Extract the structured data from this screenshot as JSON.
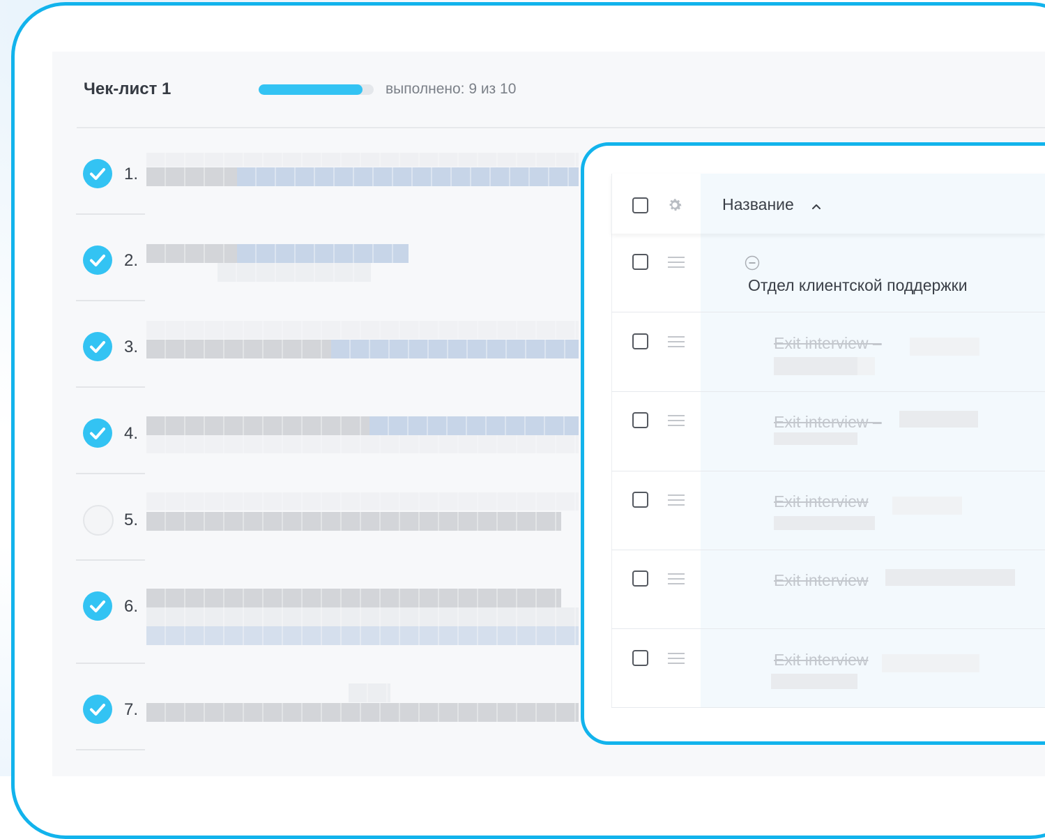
{
  "checklist": {
    "title": "Чек-лист 1",
    "progress_text": "выполнено: 9 из 10",
    "progress_fraction": 0.9,
    "accent_color": "#33c3f3",
    "tasks": [
      {
        "number": "1.",
        "done": true
      },
      {
        "number": "2.",
        "done": true
      },
      {
        "number": "3.",
        "done": true
      },
      {
        "number": "4.",
        "done": true
      },
      {
        "number": "5.",
        "done": false
      },
      {
        "number": "6.",
        "done": true
      },
      {
        "number": "7.",
        "done": true
      }
    ]
  },
  "table": {
    "column_name": "Название",
    "sort_icon": "chevron-up-icon",
    "settings_icon": "gear-icon",
    "group": {
      "label": "Отдел клиентской поддержки",
      "icon": "collapse-minus-icon"
    },
    "rows": [
      {
        "label": "Exit interview –",
        "done": true
      },
      {
        "label": "Exit interview –",
        "done": true
      },
      {
        "label": "Exit interview",
        "done": true
      },
      {
        "label": "Exit interview",
        "done": true
      },
      {
        "label": "Exit interview",
        "done": true
      }
    ]
  },
  "frame_color": "#12b3ec"
}
